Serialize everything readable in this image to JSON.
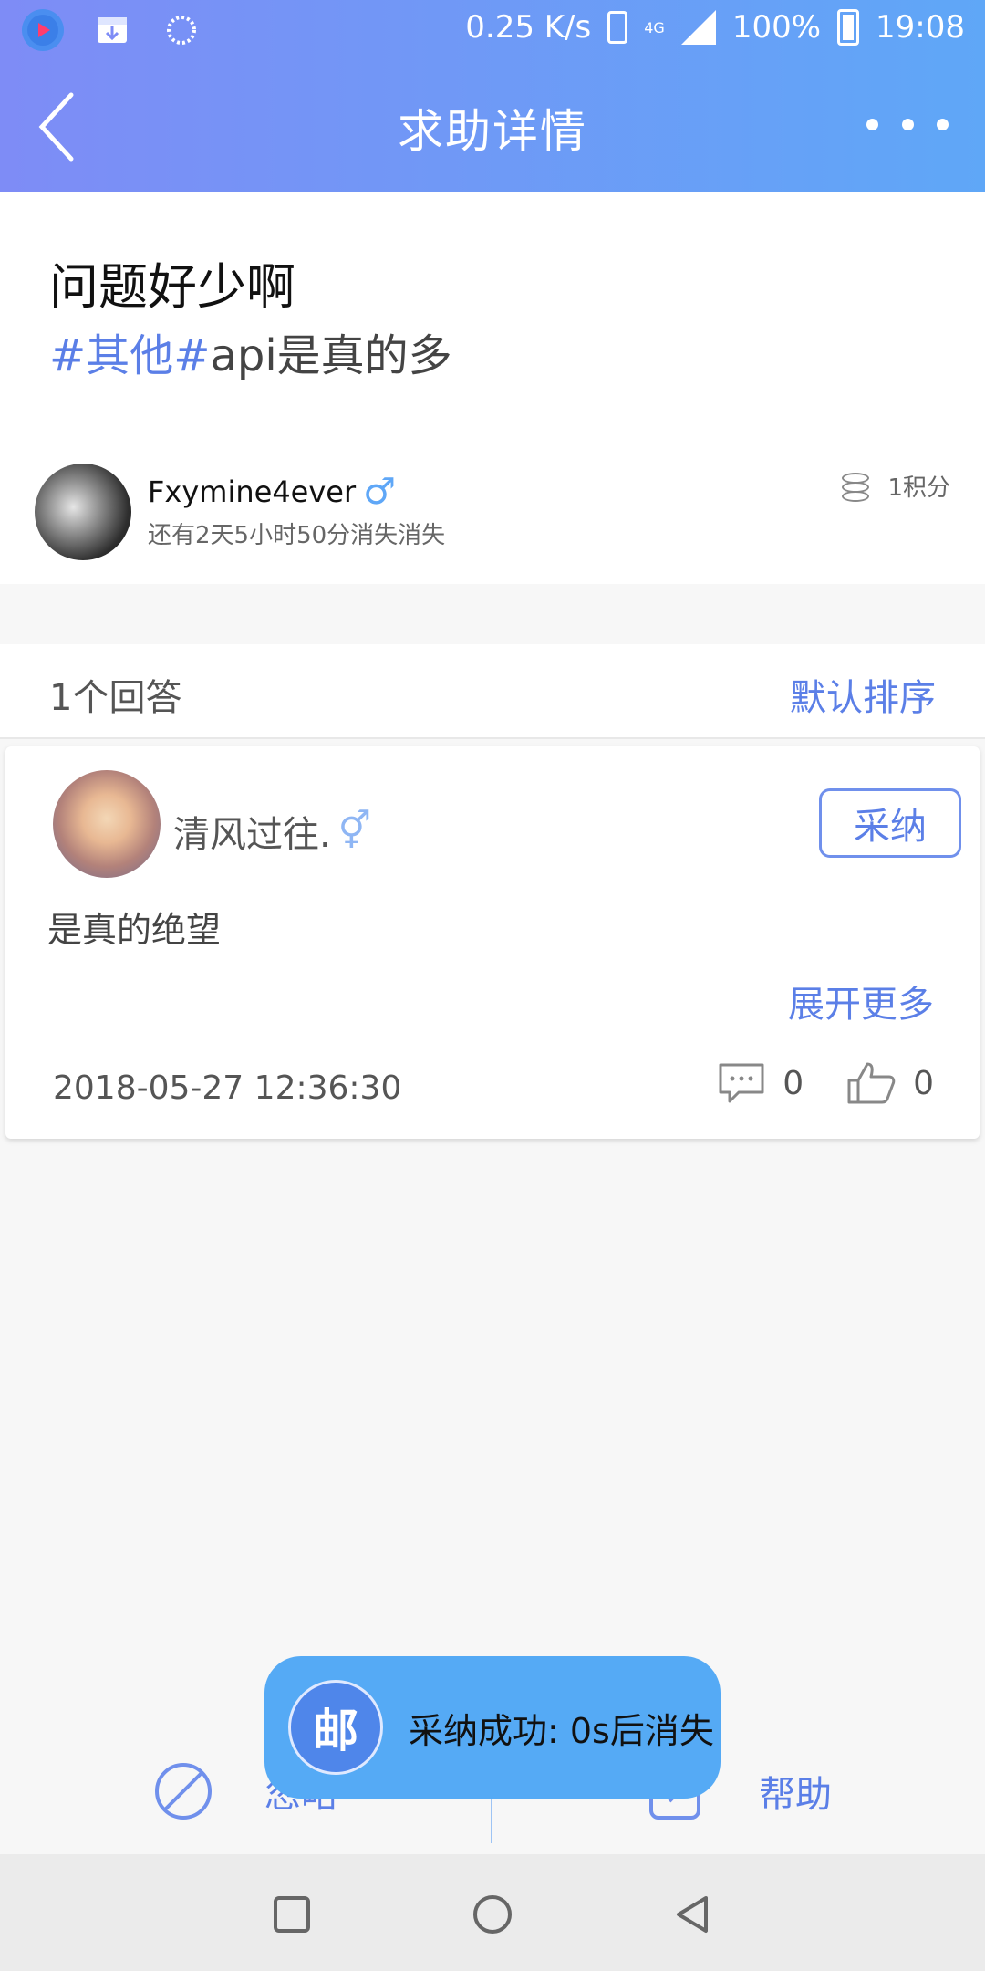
{
  "status_bar": {
    "speed": "0.25 K/s",
    "network": "4G",
    "battery": "100%",
    "time": "19:08"
  },
  "header": {
    "title": "求助详情"
  },
  "question": {
    "title": "问题好少啊",
    "tags": [
      "#其他#"
    ],
    "tag_suffix": "api是真的多",
    "author": {
      "name": "Fxymine4ever",
      "gender_symbol": "♂",
      "expire_text": "还有2天5小时50分消失消失"
    },
    "points": "1积分"
  },
  "answers_header": {
    "count_label": "1个回答",
    "sort_label": "默认排序"
  },
  "answer": {
    "author": "清风过往.",
    "gender_symbol": "⚥",
    "adopt_label": "采纳",
    "content": "是真的绝望",
    "expand_label": "展开更多",
    "date": "2018-05-27 12:36:30",
    "comment_count": "0",
    "like_count": "0"
  },
  "bottom_bar": {
    "ignore_label": "忽略",
    "help_label": "帮助"
  },
  "toast": {
    "logo_text": "邮",
    "message": "采纳成功: 0s后消失"
  },
  "colors": {
    "accent": "#5b7fe7",
    "header_start": "#7e8cf6",
    "header_end": "#5fa7f7",
    "toast_bg": "#55aaf5"
  }
}
